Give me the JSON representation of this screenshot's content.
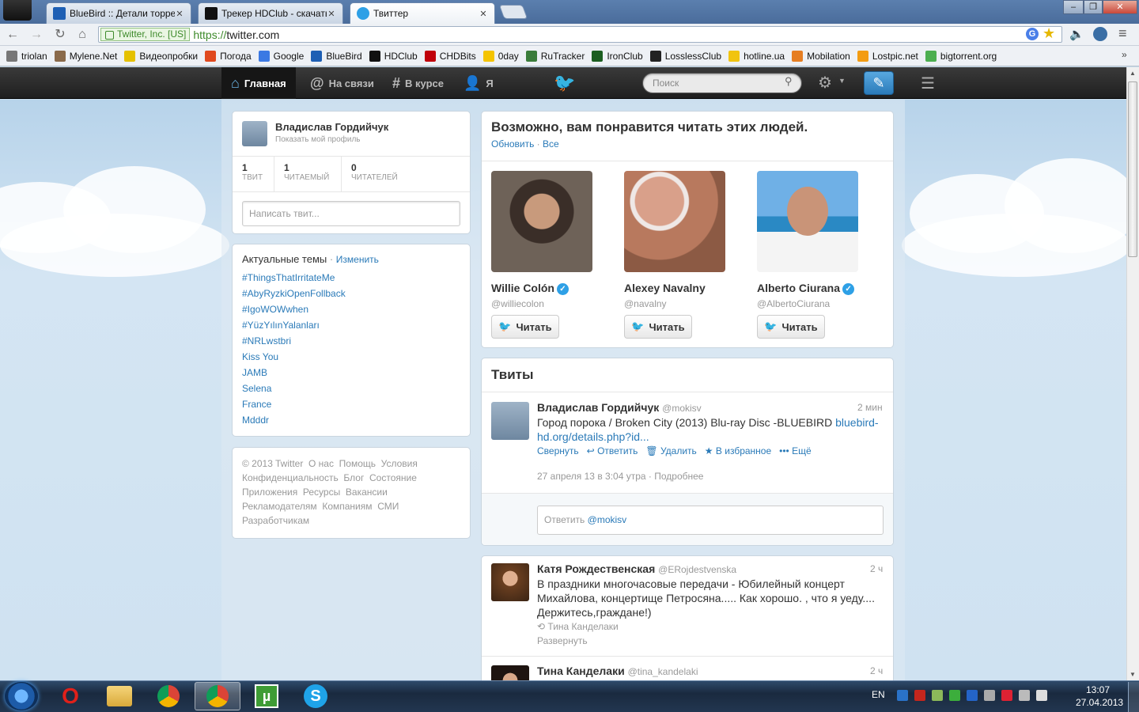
{
  "browser": {
    "tabs": [
      {
        "label": "BlueBird :: Детали торрен",
        "icon": "bluebird-icon",
        "color": "#1d5fb4"
      },
      {
        "label": "Трекер HDClub - скачать",
        "icon": "hdclub-icon",
        "color": "#111111"
      },
      {
        "label": "Твиттер",
        "icon": "twitter-bird-icon",
        "color": "#2ea0e6",
        "active": true
      }
    ],
    "address": {
      "ev_badge": "Twitter, Inc. [US]",
      "scheme": "https://",
      "host": "twitter.com"
    },
    "bookmarks": [
      {
        "label": "triolan",
        "color": "#777777"
      },
      {
        "label": "Mylene.Net",
        "color": "#8a6a4a"
      },
      {
        "label": "Видеопробки",
        "color": "#e5c100"
      },
      {
        "label": "Погода",
        "color": "#e0491e"
      },
      {
        "label": "Google",
        "color": "#3b79e3"
      },
      {
        "label": "BlueBird",
        "color": "#1d5fb4"
      },
      {
        "label": "HDClub",
        "color": "#111111"
      },
      {
        "label": "CHDBits",
        "color": "#c0000a"
      },
      {
        "label": "0day",
        "color": "#f4c400"
      },
      {
        "label": "RuTracker",
        "color": "#3a7c3a"
      },
      {
        "label": "IronClub",
        "color": "#1b5e20"
      },
      {
        "label": "LosslessClub",
        "color": "#222222"
      },
      {
        "label": "hotline.ua",
        "color": "#f1c40f"
      },
      {
        "label": "Mobilation",
        "color": "#e67e22"
      },
      {
        "label": "Lostpic.net",
        "color": "#f39c12"
      },
      {
        "label": "bigtorrent.org",
        "color": "#4caf50"
      }
    ]
  },
  "twitter_nav": {
    "home": "Главная",
    "connect": "На связи",
    "discover": "В курсе",
    "me": "Я",
    "search_placeholder": "Поиск"
  },
  "profile_card": {
    "name": "Владислав Гордийчук",
    "subtitle": "Показать мой профиль",
    "stats": [
      {
        "value": "1",
        "label": "ТВИТ"
      },
      {
        "value": "1",
        "label": "ЧИТАЕМЫЙ"
      },
      {
        "value": "0",
        "label": "ЧИТАТЕЛЕЙ"
      }
    ],
    "compose_placeholder": "Написать твит..."
  },
  "trends": {
    "title": "Актуальные темы",
    "change": "Изменить",
    "items": [
      "#ThingsThatIrritateMe",
      "#AbyRyzkiOpenFollback",
      "#IgoWOWwhen",
      "#YüzYılınYalanları",
      "#NRLwstbri",
      "Kiss You",
      "JAMB",
      "Selena",
      "France",
      "Mdddr"
    ]
  },
  "footer": {
    "lines": [
      [
        "© 2013 Twitter",
        "О нас",
        "Помощь",
        "Условия"
      ],
      [
        "Конфиденциальность",
        "Блог",
        "Состояние"
      ],
      [
        "Приложения",
        "Ресурсы",
        "Вакансии"
      ],
      [
        "Рекламодателям",
        "Компаниям",
        "СМИ"
      ],
      [
        "Разработчикам"
      ]
    ]
  },
  "suggestions": {
    "title": "Возможно, вам понравится читать этих людей.",
    "refresh": "Обновить",
    "all": "Все",
    "people": [
      {
        "name": "Willie Colón",
        "handle": "@williecolon",
        "verified": true,
        "follow": "Читать"
      },
      {
        "name": "Alexey Navalny",
        "handle": "@navalny",
        "verified": false,
        "follow": "Читать"
      },
      {
        "name": "Alberto Ciurana",
        "handle": "@AlbertoCiurana",
        "verified": true,
        "follow": "Читать"
      }
    ]
  },
  "tweets": {
    "title": "Твиты",
    "first": {
      "name": "Владислав Гордийчук",
      "handle": "@mokisv",
      "time": "2 мин",
      "text": "Город порока / Broken City (2013) Blu-ray Disc -BLUEBIRD ",
      "link": "bluebird-hd.org/details.php?id...",
      "actions": {
        "collapse": "Свернуть",
        "reply": "Ответить",
        "delete": "Удалить",
        "favorite": "В избранное",
        "more": "Ещё"
      },
      "date": "27 апреля 13 в 3:04 утра",
      "details": "Подробнее",
      "reply_prefix": "Ответить",
      "reply_mention": "@mokisv"
    },
    "second": {
      "name": "Катя Рождественская",
      "handle": "@ERojdestvenska",
      "time": "2 ч",
      "text": "В праздники многочасовые передачи - Юбилейный концерт Михайлова, концертище Петросяна..... Как хорошо. , что я уеду.... Держитесь,граждане!)",
      "retweeted_by": "Тина Канделаки",
      "expand": "Развернуть"
    },
    "third": {
      "name": "Тина Канделаки",
      "handle": "@tina_kandelaki",
      "time": "2 ч"
    }
  },
  "taskbar": {
    "lang": "EN",
    "time": "13:07",
    "date": "27.04.2013"
  }
}
